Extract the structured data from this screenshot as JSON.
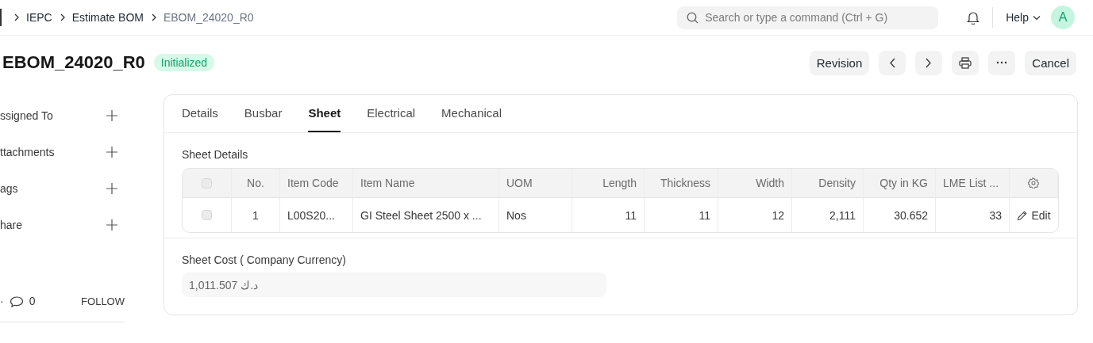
{
  "breadcrumbs": [
    {
      "label": "IEPC",
      "current": false
    },
    {
      "label": "Estimate BOM",
      "current": false
    },
    {
      "label": "EBOM_24020_R0",
      "current": true
    }
  ],
  "navbar": {
    "search_placeholder": "Search or type a command (Ctrl + G)",
    "help": "Help",
    "avatar": "A"
  },
  "page": {
    "title": "EBOM_24020_R0",
    "status": "Initialized"
  },
  "actions": [
    {
      "kind": "text",
      "label": "Revision"
    },
    {
      "kind": "previous"
    },
    {
      "kind": "next"
    },
    {
      "kind": "print"
    },
    {
      "kind": "more"
    },
    {
      "kind": "text",
      "label": "Cancel"
    }
  ],
  "sidebar": {
    "items": [
      {
        "label": "ssigned To"
      },
      {
        "label": "ttachments"
      },
      {
        "label": "ags"
      },
      {
        "label": "hare"
      }
    ],
    "separator": "·",
    "comment_count": "0",
    "follow": "FOLLOW"
  },
  "tabs": [
    {
      "label": "Details",
      "selected": false
    },
    {
      "label": "Busbar",
      "selected": false
    },
    {
      "label": "Sheet",
      "selected": true
    },
    {
      "label": "Electrical",
      "selected": false
    },
    {
      "label": "Mechanical",
      "selected": false
    }
  ],
  "section_title": "Sheet Details",
  "table": {
    "header_checked": false,
    "columns": [
      "No.",
      "Item Code",
      "Item Name",
      "UOM",
      "Length",
      "Thickness",
      "Width",
      "Density",
      "Qty in KG",
      "LME List ..."
    ],
    "rows": [
      {
        "checked": false,
        "cells": [
          "1",
          "L00S20...",
          "GI Steel Sheet 2500 x ...",
          "Nos",
          "11",
          "11",
          "12",
          "2,111",
          "30.652",
          "33"
        ],
        "action": "Edit"
      }
    ]
  },
  "cost_field": {
    "label": "Sheet Cost ( Company Currency)",
    "value": "1,011.507 د.ك"
  }
}
